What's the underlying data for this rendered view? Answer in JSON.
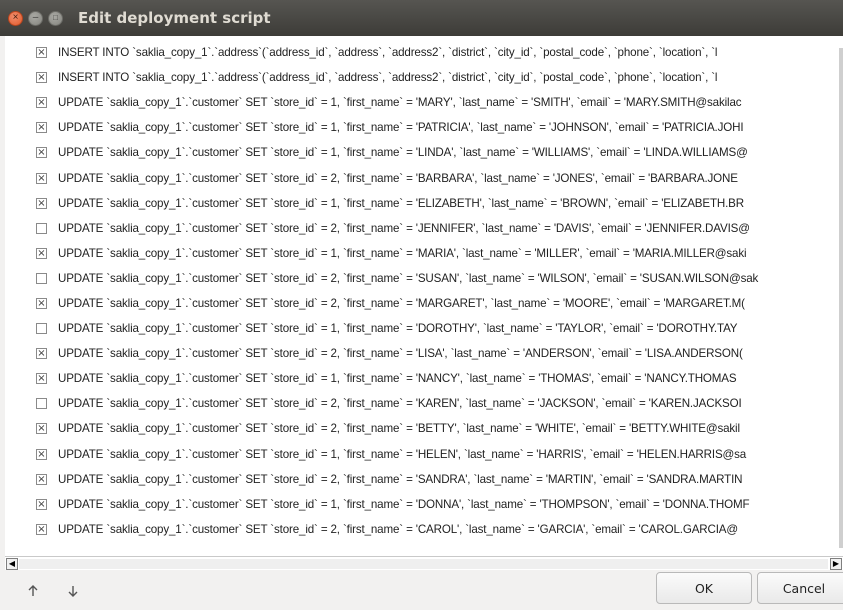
{
  "window": {
    "title": "Edit deployment script",
    "close_glyph": "×",
    "minimize_glyph": "–",
    "maximize_glyph": "□"
  },
  "rows": [
    {
      "checked": true,
      "text": "INSERT INTO `saklia_copy_1`.`address`(`address_id`, `address`, `address2`, `district`, `city_id`, `postal_code`, `phone`, `location`, `l"
    },
    {
      "checked": true,
      "text": "INSERT INTO `saklia_copy_1`.`address`(`address_id`, `address`, `address2`, `district`, `city_id`, `postal_code`, `phone`, `location`, `l"
    },
    {
      "checked": true,
      "text": "UPDATE `saklia_copy_1`.`customer` SET `store_id` = 1, `first_name` = 'MARY', `last_name` = 'SMITH', `email` = 'MARY.SMITH@sakilac"
    },
    {
      "checked": true,
      "text": "UPDATE `saklia_copy_1`.`customer` SET `store_id` = 1, `first_name` = 'PATRICIA', `last_name` = 'JOHNSON', `email` = 'PATRICIA.JOHI"
    },
    {
      "checked": true,
      "text": "UPDATE `saklia_copy_1`.`customer` SET `store_id` = 1, `first_name` = 'LINDA', `last_name` = 'WILLIAMS', `email` = 'LINDA.WILLIAMS@"
    },
    {
      "checked": true,
      "text": "UPDATE `saklia_copy_1`.`customer` SET `store_id` = 2, `first_name` = 'BARBARA', `last_name` = 'JONES', `email` = 'BARBARA.JONE"
    },
    {
      "checked": true,
      "text": "UPDATE `saklia_copy_1`.`customer` SET `store_id` = 1, `first_name` = 'ELIZABETH', `last_name` = 'BROWN', `email` = 'ELIZABETH.BR"
    },
    {
      "checked": false,
      "text": "UPDATE `saklia_copy_1`.`customer` SET `store_id` = 2, `first_name` = 'JENNIFER', `last_name` = 'DAVIS', `email` = 'JENNIFER.DAVIS@"
    },
    {
      "checked": true,
      "text": "UPDATE `saklia_copy_1`.`customer` SET `store_id` = 1, `first_name` = 'MARIA', `last_name` = 'MILLER', `email` = 'MARIA.MILLER@saki"
    },
    {
      "checked": false,
      "text": "UPDATE `saklia_copy_1`.`customer` SET `store_id` = 2, `first_name` = 'SUSAN', `last_name` = 'WILSON', `email` = 'SUSAN.WILSON@sak"
    },
    {
      "checked": true,
      "text": "UPDATE `saklia_copy_1`.`customer` SET `store_id` = 2, `first_name` = 'MARGARET', `last_name` = 'MOORE', `email` = 'MARGARET.M("
    },
    {
      "checked": false,
      "text": "UPDATE `saklia_copy_1`.`customer` SET `store_id` = 1, `first_name` = 'DOROTHY', `last_name` = 'TAYLOR', `email` = 'DOROTHY.TAY"
    },
    {
      "checked": true,
      "text": "UPDATE `saklia_copy_1`.`customer` SET `store_id` = 2, `first_name` = 'LISA', `last_name` = 'ANDERSON', `email` = 'LISA.ANDERSON("
    },
    {
      "checked": true,
      "text": "UPDATE `saklia_copy_1`.`customer` SET `store_id` = 1, `first_name` = 'NANCY', `last_name` = 'THOMAS', `email` = 'NANCY.THOMAS"
    },
    {
      "checked": false,
      "text": "UPDATE `saklia_copy_1`.`customer` SET `store_id` = 2, `first_name` = 'KAREN', `last_name` = 'JACKSON', `email` = 'KAREN.JACKSOI"
    },
    {
      "checked": true,
      "text": "UPDATE `saklia_copy_1`.`customer` SET `store_id` = 2, `first_name` = 'BETTY', `last_name` = 'WHITE', `email` = 'BETTY.WHITE@sakil"
    },
    {
      "checked": true,
      "text": "UPDATE `saklia_copy_1`.`customer` SET `store_id` = 1, `first_name` = 'HELEN', `last_name` = 'HARRIS', `email` = 'HELEN.HARRIS@sa"
    },
    {
      "checked": true,
      "text": "UPDATE `saklia_copy_1`.`customer` SET `store_id` = 2, `first_name` = 'SANDRA', `last_name` = 'MARTIN', `email` = 'SANDRA.MARTIN"
    },
    {
      "checked": true,
      "text": "UPDATE `saklia_copy_1`.`customer` SET `store_id` = 1, `first_name` = 'DONNA', `last_name` = 'THOMPSON', `email` = 'DONNA.THOMF"
    },
    {
      "checked": true,
      "text": "UPDATE `saklia_copy_1`.`customer` SET `store_id` = 2, `first_name` = 'CAROL', `last_name` = 'GARCIA', `email` = 'CAROL.GARCIA@"
    }
  ],
  "scrollbar": {
    "left_glyph": "◀",
    "right_glyph": "▶"
  },
  "footer": {
    "move_up_icon": "up-arrow-icon",
    "move_down_icon": "down-arrow-icon",
    "ok_label": "OK",
    "cancel_label": "Cancel"
  },
  "colors": {
    "titlebar": "#3d3c38",
    "close_button": "#e05a2c",
    "dialog_background": "#f2f1f0",
    "list_background": "#ffffff"
  }
}
